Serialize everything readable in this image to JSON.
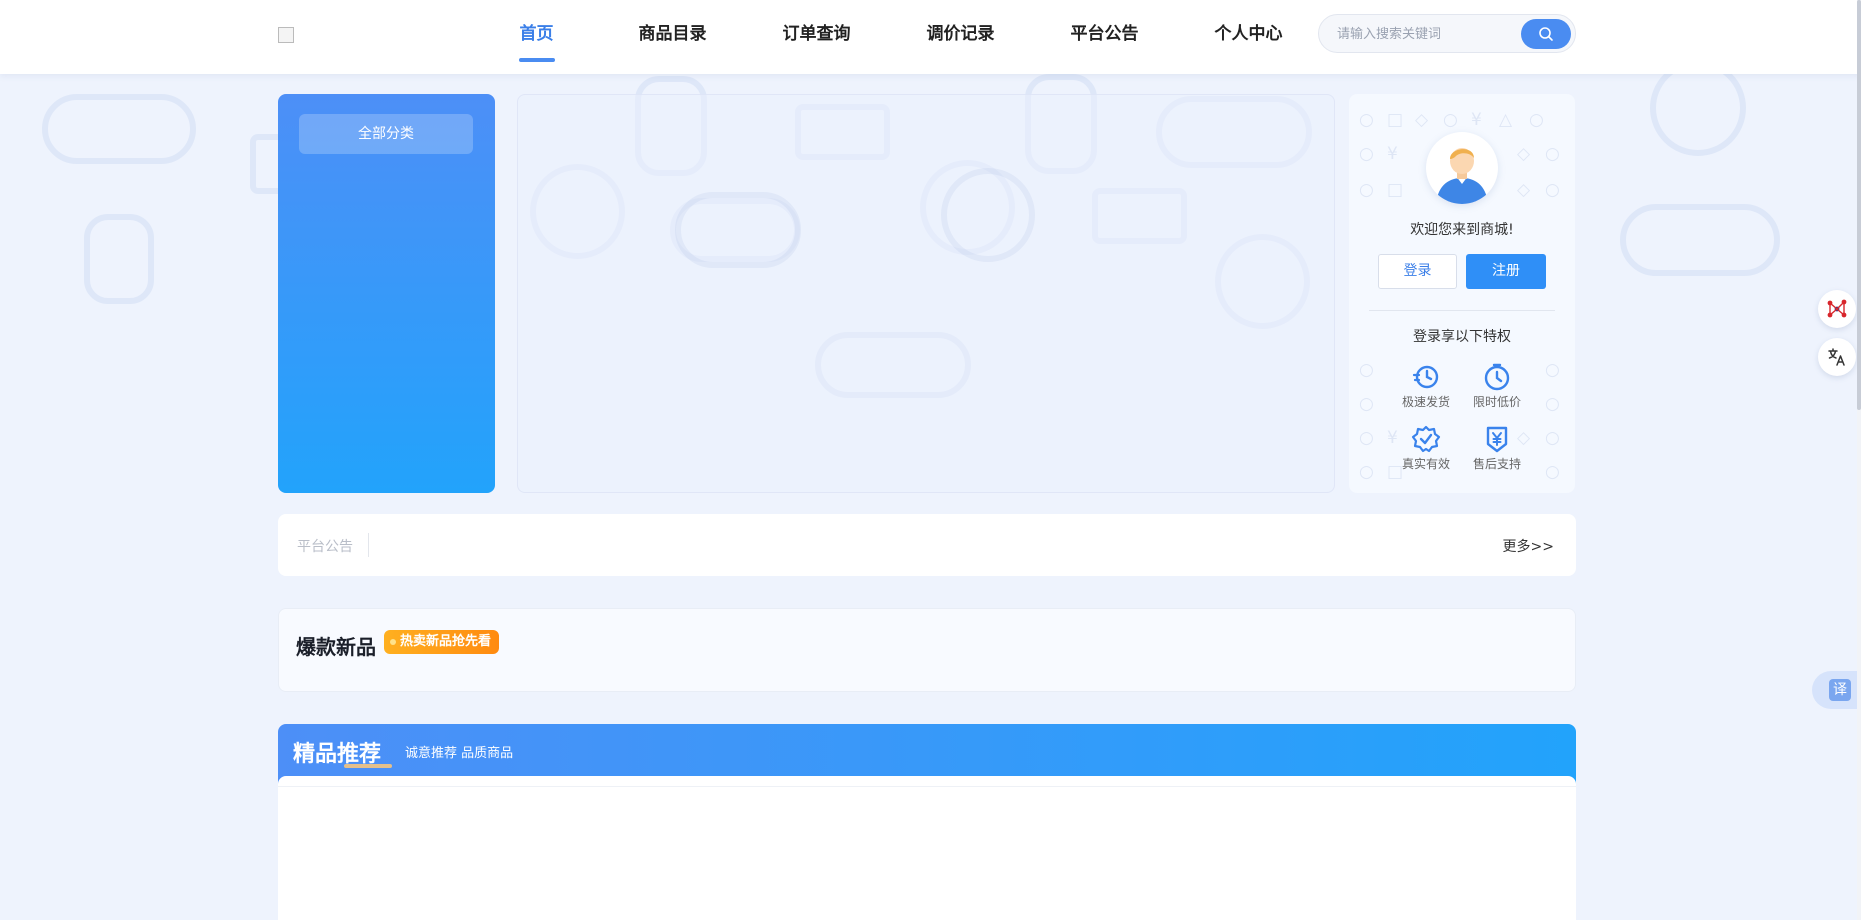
{
  "header": {
    "nav": [
      {
        "label": "首页",
        "active": true
      },
      {
        "label": "商品目录",
        "active": false
      },
      {
        "label": "订单查询",
        "active": false
      },
      {
        "label": "调价记录",
        "active": false
      },
      {
        "label": "平台公告",
        "active": false
      },
      {
        "label": "个人中心",
        "active": false
      }
    ],
    "search": {
      "placeholder": "请输入搜索关键词",
      "value": ""
    }
  },
  "category": {
    "all_label": "全部分类"
  },
  "user_card": {
    "welcome": "欢迎您来到商城!",
    "login_label": "登录",
    "register_label": "注册",
    "privilege_title": "登录享以下特权",
    "perks": [
      {
        "label": "极速发货",
        "icon": "clock-fast-icon"
      },
      {
        "label": "限时低价",
        "icon": "timer-icon"
      },
      {
        "label": "真实有效",
        "icon": "verified-badge-icon"
      },
      {
        "label": "售后支持",
        "icon": "yen-shield-icon"
      }
    ]
  },
  "notice": {
    "label": "平台公告",
    "more": "更多>>"
  },
  "new_products": {
    "title": "爆款新品",
    "tag": "热卖新品抢先看"
  },
  "recommend": {
    "title": "精品推荐",
    "subtitle": "诚意推荐 品质商品"
  },
  "float_tools": {
    "translate_label": "译"
  },
  "colors": {
    "primary": "#4a8cf1",
    "gradient_start": "#4d8ff7",
    "gradient_end": "#22a3fb",
    "tag_orange": "#ff8a10"
  }
}
